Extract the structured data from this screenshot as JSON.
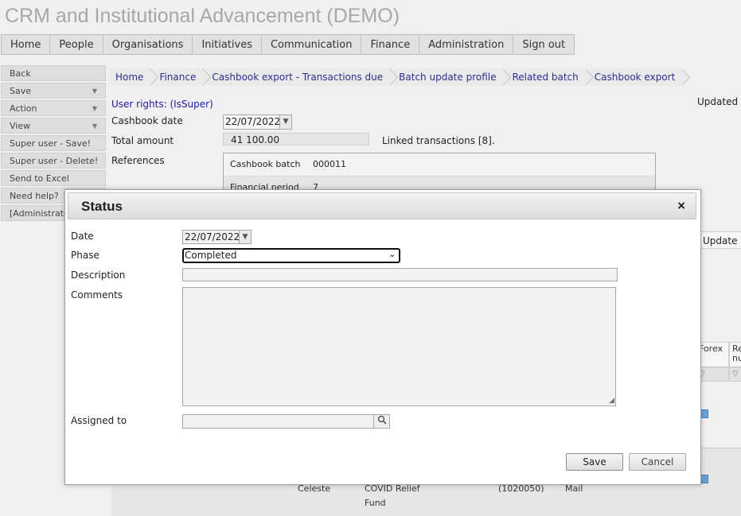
{
  "app": {
    "title": "CRM and Institutional Advancement (DEMO)"
  },
  "topnav": [
    "Home",
    "People",
    "Organisations",
    "Initiatives",
    "Communication",
    "Finance",
    "Administration",
    "Sign out"
  ],
  "sidebar": [
    {
      "label": "Back",
      "dropdown": false
    },
    {
      "label": "Save",
      "dropdown": true
    },
    {
      "label": "Action",
      "dropdown": true
    },
    {
      "label": "View",
      "dropdown": true
    },
    {
      "label": "Super user - Save!",
      "dropdown": false
    },
    {
      "label": "Super user - Delete!",
      "dropdown": false
    },
    {
      "label": "Send to Excel",
      "dropdown": false
    },
    {
      "label": "Need help?",
      "dropdown": false
    },
    {
      "label": "[Administrator]",
      "dropdown": false
    }
  ],
  "breadcrumb": [
    "Home",
    "Finance",
    "Cashbook export - Transactions due",
    "Batch update profile",
    "Related batch",
    "Cashbook export"
  ],
  "page": {
    "user_rights": "User rights: (IsSuper)",
    "updated_on": "Updated on",
    "cashbook_date_label": "Cashbook date",
    "cashbook_date": "22/07/2022",
    "total_amount_label": "Total amount",
    "total_amount": "41 100.00",
    "linked_transactions": "Linked transactions [8].",
    "references_label": "References",
    "references": [
      {
        "key": "Cashbook batch",
        "value": "000011"
      },
      {
        "key": "Financial period",
        "value": "7"
      }
    ],
    "update_header": "Update",
    "grid_headers": [
      "Forex",
      "Re nu"
    ],
    "bottom_row": {
      "name": "Celeste",
      "fund_line1": "COVID Relief",
      "fund_line2": "Fund",
      "code": "(1020050)",
      "method": "Mail"
    }
  },
  "modal": {
    "title": "Status",
    "close_glyph": "×",
    "date_label": "Date",
    "date_value": "22/07/2022",
    "phase_label": "Phase",
    "phase_value": "Completed",
    "description_label": "Description",
    "description_value": "",
    "comments_label": "Comments",
    "comments_value": "",
    "assigned_label": "Assigned to",
    "assigned_value": "",
    "save_label": "Save",
    "cancel_label": "Cancel"
  },
  "icons": {
    "dropdown": "chevron-down-icon",
    "lookup": "search-icon",
    "filter": "filter-icon",
    "close": "close-icon"
  }
}
